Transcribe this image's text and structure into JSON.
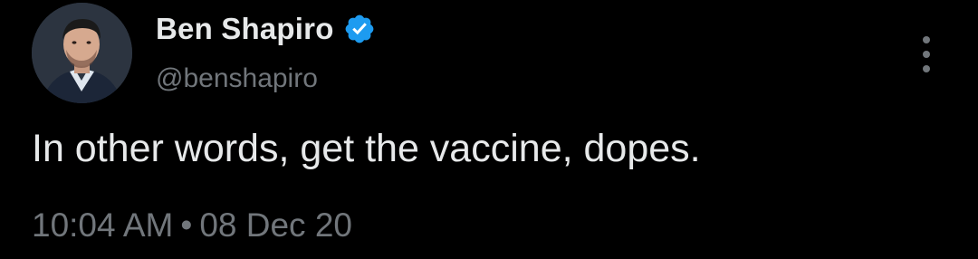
{
  "tweet": {
    "author_name": "Ben Shapiro",
    "handle": "@benshapiro",
    "verified_icon": "verified-badge-icon",
    "text": "In other words, get the vaccine, dopes.",
    "time": "10:04 AM",
    "separator": "•",
    "date": "08 Dec 20",
    "more_icon": "more-options-icon"
  },
  "colors": {
    "background": "#000000",
    "primary_text": "#e7e9ea",
    "secondary_text": "#71767b",
    "verified_blue": "#1d9bf0"
  }
}
